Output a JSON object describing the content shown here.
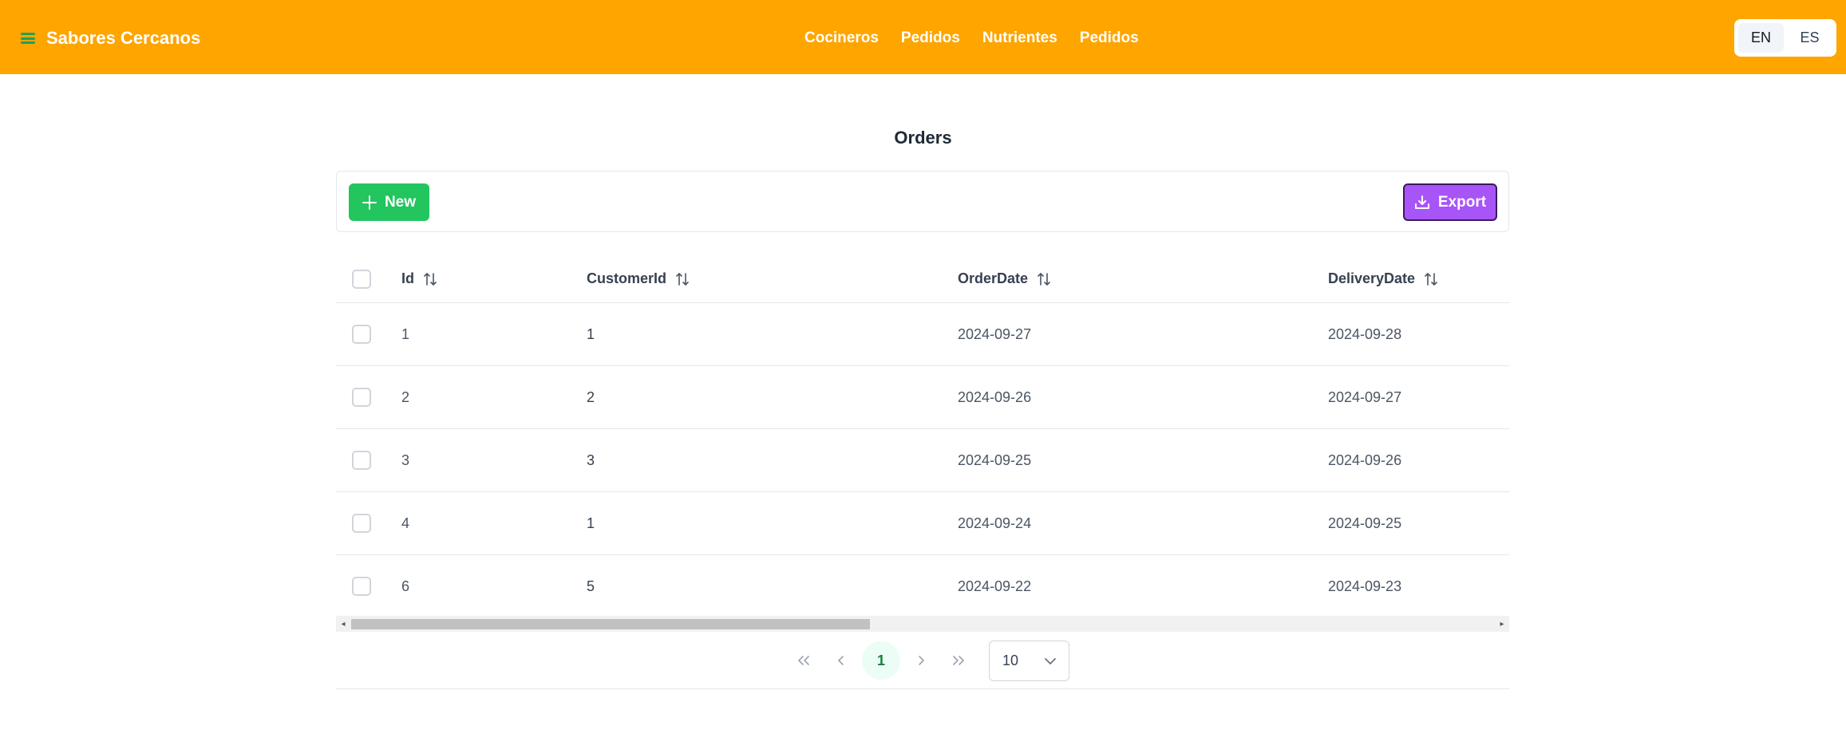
{
  "header": {
    "brand": "Sabores Cercanos",
    "nav": [
      "Cocineros",
      "Pedidos",
      "Nutrientes",
      "Pedidos"
    ],
    "languages": [
      "EN",
      "ES"
    ],
    "active_language": "EN",
    "background_color": "#fea500"
  },
  "page": {
    "title": "Orders"
  },
  "toolbar": {
    "new_label": "New",
    "export_label": "Export",
    "new_color": "#22c55e",
    "export_color": "#a855f7"
  },
  "table": {
    "columns": [
      "Id",
      "CustomerId",
      "OrderDate",
      "DeliveryDate"
    ],
    "rows": [
      {
        "id": "1",
        "customer_id": "1",
        "order_date": "2024-09-27",
        "delivery_date": "2024-09-28"
      },
      {
        "id": "2",
        "customer_id": "2",
        "order_date": "2024-09-26",
        "delivery_date": "2024-09-27"
      },
      {
        "id": "3",
        "customer_id": "3",
        "order_date": "2024-09-25",
        "delivery_date": "2024-09-26"
      },
      {
        "id": "4",
        "customer_id": "1",
        "order_date": "2024-09-24",
        "delivery_date": "2024-09-25"
      },
      {
        "id": "6",
        "customer_id": "5",
        "order_date": "2024-09-22",
        "delivery_date": "2024-09-23"
      }
    ]
  },
  "paginator": {
    "current_page": "1",
    "rows_per_page": "10",
    "icons": [
      "double-chevron-left-icon",
      "chevron-left-icon",
      "chevron-right-icon",
      "double-chevron-right-icon"
    ]
  }
}
